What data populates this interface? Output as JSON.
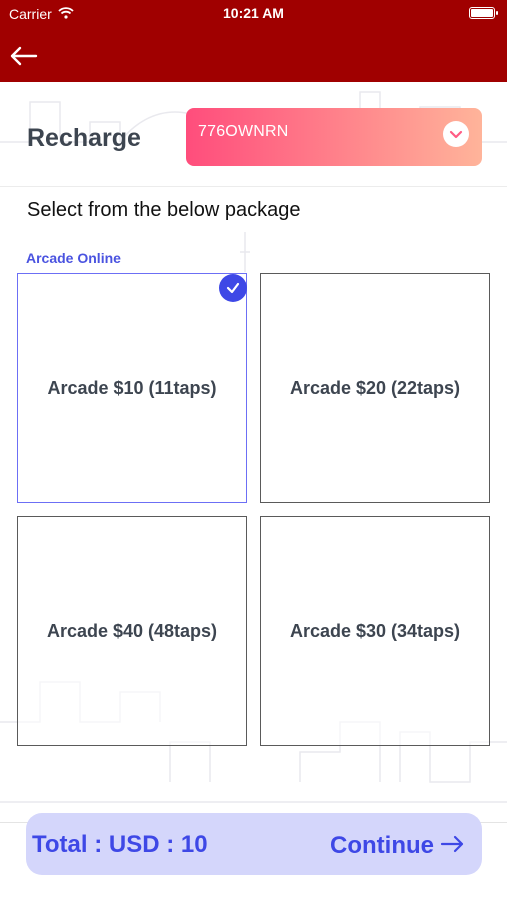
{
  "status_bar": {
    "carrier": "Carrier",
    "time": "10:21 AM"
  },
  "header": {
    "back_icon": "arrow-left-icon"
  },
  "recharge": {
    "label": "Recharge",
    "card_value": "776OWNRN",
    "chevron_icon": "chevron-down-icon"
  },
  "section_title": "Select from the below package",
  "category": "Arcade Online",
  "packages": [
    {
      "label": "Arcade $10 (11taps)",
      "selected": true
    },
    {
      "label": "Arcade $20 (22taps)",
      "selected": false
    },
    {
      "label": "Arcade $40 (48taps)",
      "selected": false
    },
    {
      "label": "Arcade $30 (34taps)",
      "selected": false
    }
  ],
  "footer": {
    "total": "Total : USD : 10",
    "continue_label": "Continue"
  },
  "colors": {
    "header_red": "#a00000",
    "accent_blue": "#3e48e6",
    "footer_bg": "#d4d6fb",
    "gradient_start": "#ff4d7c",
    "gradient_end": "#ffb49a"
  }
}
